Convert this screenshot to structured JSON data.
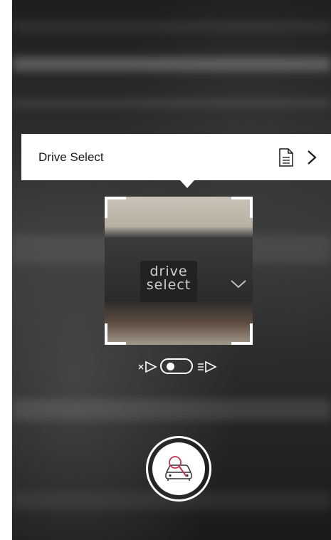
{
  "result_card": {
    "title": "Drive Select"
  },
  "viewfinder": {
    "button_label_line1": "drive",
    "button_label_line2": "select"
  },
  "flash": {
    "state": "off"
  },
  "icons": {
    "document": "document-icon",
    "chevron": "chevron-right-icon",
    "flash_off": "flash-off-icon",
    "flash_on": "flash-on-icon",
    "search_car": "car-search-icon"
  },
  "colors": {
    "accent": "#c0334d",
    "card_bg": "#ffffff"
  }
}
